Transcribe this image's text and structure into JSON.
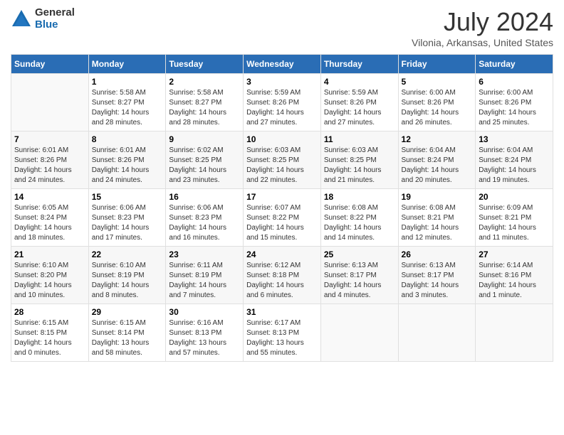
{
  "logo": {
    "general": "General",
    "blue": "Blue"
  },
  "header": {
    "month": "July 2024",
    "location": "Vilonia, Arkansas, United States"
  },
  "weekdays": [
    "Sunday",
    "Monday",
    "Tuesday",
    "Wednesday",
    "Thursday",
    "Friday",
    "Saturday"
  ],
  "weeks": [
    [
      {
        "day": "",
        "info": ""
      },
      {
        "day": "1",
        "info": "Sunrise: 5:58 AM\nSunset: 8:27 PM\nDaylight: 14 hours\nand 28 minutes."
      },
      {
        "day": "2",
        "info": "Sunrise: 5:58 AM\nSunset: 8:27 PM\nDaylight: 14 hours\nand 28 minutes."
      },
      {
        "day": "3",
        "info": "Sunrise: 5:59 AM\nSunset: 8:26 PM\nDaylight: 14 hours\nand 27 minutes."
      },
      {
        "day": "4",
        "info": "Sunrise: 5:59 AM\nSunset: 8:26 PM\nDaylight: 14 hours\nand 27 minutes."
      },
      {
        "day": "5",
        "info": "Sunrise: 6:00 AM\nSunset: 8:26 PM\nDaylight: 14 hours\nand 26 minutes."
      },
      {
        "day": "6",
        "info": "Sunrise: 6:00 AM\nSunset: 8:26 PM\nDaylight: 14 hours\nand 25 minutes."
      }
    ],
    [
      {
        "day": "7",
        "info": "Sunrise: 6:01 AM\nSunset: 8:26 PM\nDaylight: 14 hours\nand 24 minutes."
      },
      {
        "day": "8",
        "info": "Sunrise: 6:01 AM\nSunset: 8:26 PM\nDaylight: 14 hours\nand 24 minutes."
      },
      {
        "day": "9",
        "info": "Sunrise: 6:02 AM\nSunset: 8:25 PM\nDaylight: 14 hours\nand 23 minutes."
      },
      {
        "day": "10",
        "info": "Sunrise: 6:03 AM\nSunset: 8:25 PM\nDaylight: 14 hours\nand 22 minutes."
      },
      {
        "day": "11",
        "info": "Sunrise: 6:03 AM\nSunset: 8:25 PM\nDaylight: 14 hours\nand 21 minutes."
      },
      {
        "day": "12",
        "info": "Sunrise: 6:04 AM\nSunset: 8:24 PM\nDaylight: 14 hours\nand 20 minutes."
      },
      {
        "day": "13",
        "info": "Sunrise: 6:04 AM\nSunset: 8:24 PM\nDaylight: 14 hours\nand 19 minutes."
      }
    ],
    [
      {
        "day": "14",
        "info": "Sunrise: 6:05 AM\nSunset: 8:24 PM\nDaylight: 14 hours\nand 18 minutes."
      },
      {
        "day": "15",
        "info": "Sunrise: 6:06 AM\nSunset: 8:23 PM\nDaylight: 14 hours\nand 17 minutes."
      },
      {
        "day": "16",
        "info": "Sunrise: 6:06 AM\nSunset: 8:23 PM\nDaylight: 14 hours\nand 16 minutes."
      },
      {
        "day": "17",
        "info": "Sunrise: 6:07 AM\nSunset: 8:22 PM\nDaylight: 14 hours\nand 15 minutes."
      },
      {
        "day": "18",
        "info": "Sunrise: 6:08 AM\nSunset: 8:22 PM\nDaylight: 14 hours\nand 14 minutes."
      },
      {
        "day": "19",
        "info": "Sunrise: 6:08 AM\nSunset: 8:21 PM\nDaylight: 14 hours\nand 12 minutes."
      },
      {
        "day": "20",
        "info": "Sunrise: 6:09 AM\nSunset: 8:21 PM\nDaylight: 14 hours\nand 11 minutes."
      }
    ],
    [
      {
        "day": "21",
        "info": "Sunrise: 6:10 AM\nSunset: 8:20 PM\nDaylight: 14 hours\nand 10 minutes."
      },
      {
        "day": "22",
        "info": "Sunrise: 6:10 AM\nSunset: 8:19 PM\nDaylight: 14 hours\nand 8 minutes."
      },
      {
        "day": "23",
        "info": "Sunrise: 6:11 AM\nSunset: 8:19 PM\nDaylight: 14 hours\nand 7 minutes."
      },
      {
        "day": "24",
        "info": "Sunrise: 6:12 AM\nSunset: 8:18 PM\nDaylight: 14 hours\nand 6 minutes."
      },
      {
        "day": "25",
        "info": "Sunrise: 6:13 AM\nSunset: 8:17 PM\nDaylight: 14 hours\nand 4 minutes."
      },
      {
        "day": "26",
        "info": "Sunrise: 6:13 AM\nSunset: 8:17 PM\nDaylight: 14 hours\nand 3 minutes."
      },
      {
        "day": "27",
        "info": "Sunrise: 6:14 AM\nSunset: 8:16 PM\nDaylight: 14 hours\nand 1 minute."
      }
    ],
    [
      {
        "day": "28",
        "info": "Sunrise: 6:15 AM\nSunset: 8:15 PM\nDaylight: 14 hours\nand 0 minutes."
      },
      {
        "day": "29",
        "info": "Sunrise: 6:15 AM\nSunset: 8:14 PM\nDaylight: 13 hours\nand 58 minutes."
      },
      {
        "day": "30",
        "info": "Sunrise: 6:16 AM\nSunset: 8:13 PM\nDaylight: 13 hours\nand 57 minutes."
      },
      {
        "day": "31",
        "info": "Sunrise: 6:17 AM\nSunset: 8:13 PM\nDaylight: 13 hours\nand 55 minutes."
      },
      {
        "day": "",
        "info": ""
      },
      {
        "day": "",
        "info": ""
      },
      {
        "day": "",
        "info": ""
      }
    ]
  ]
}
